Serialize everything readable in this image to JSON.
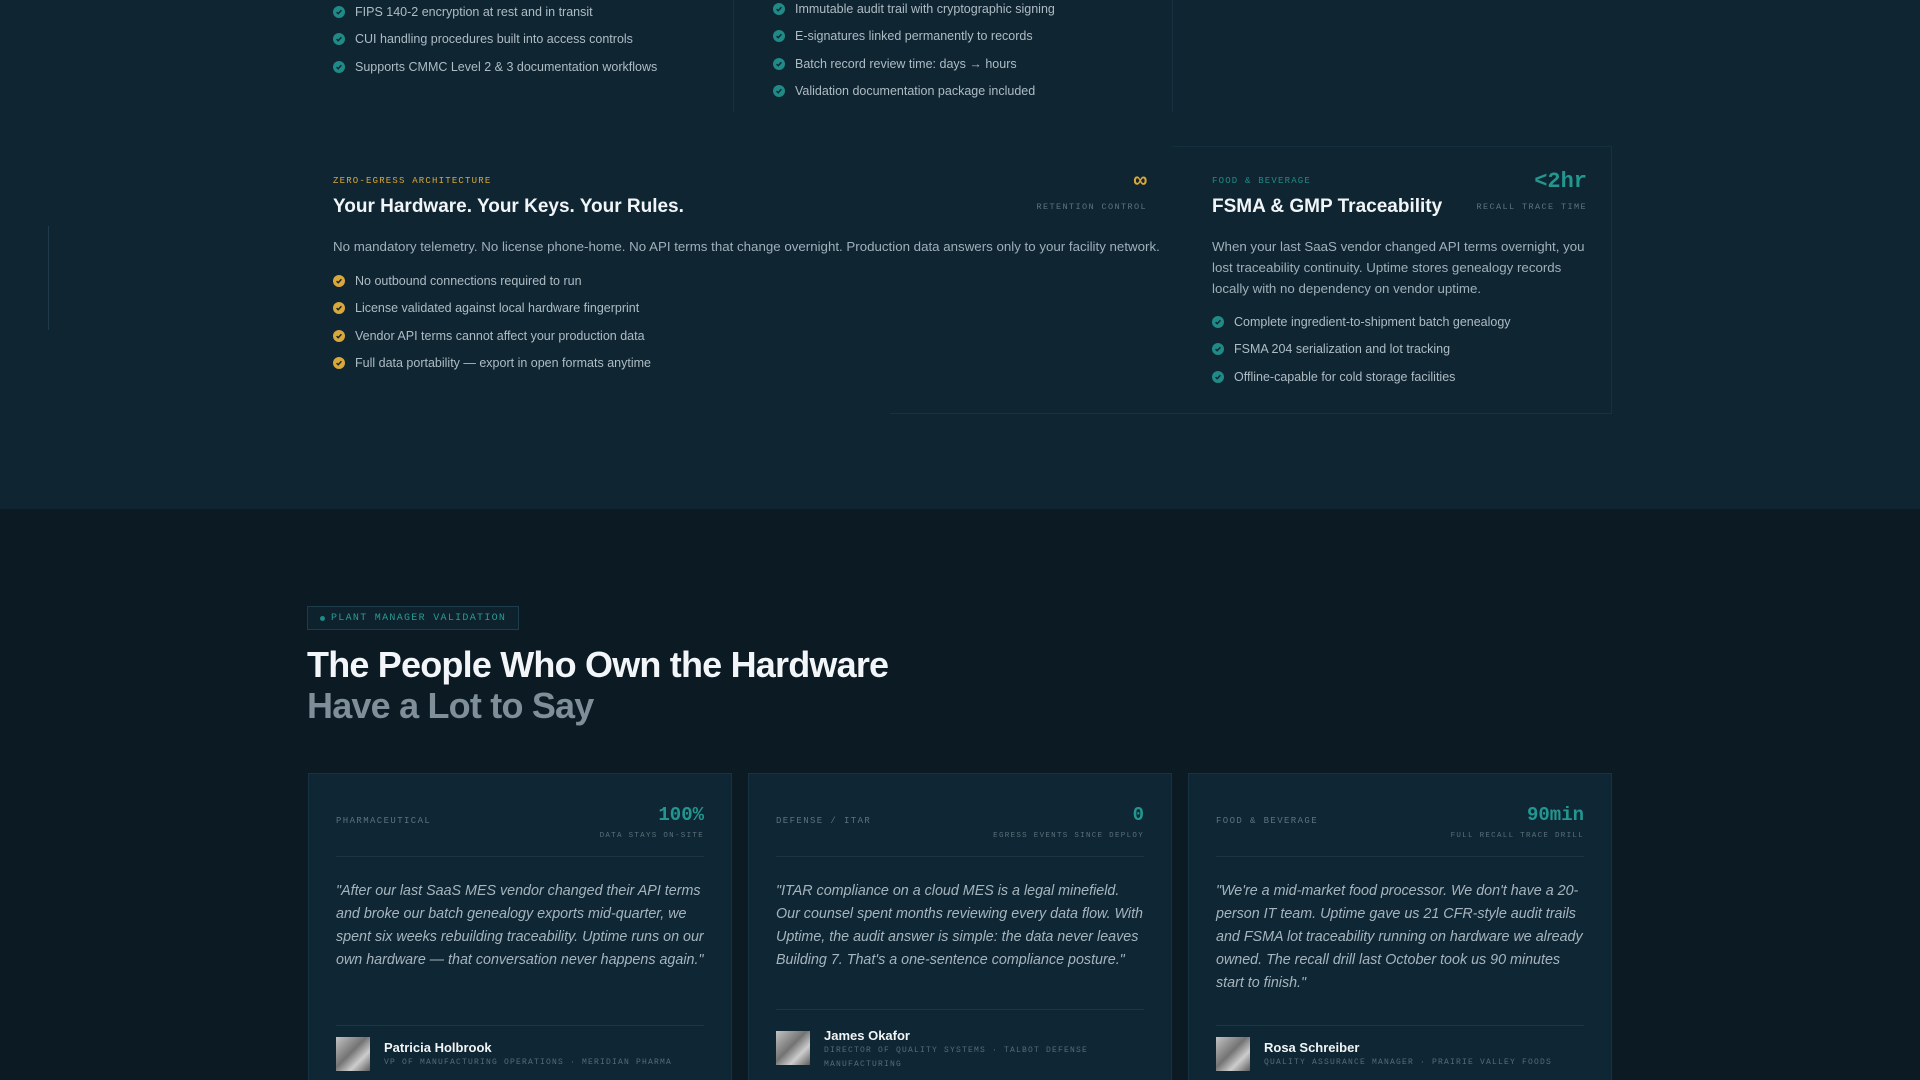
{
  "colors": {
    "accent_teal": "#1f8a86",
    "accent_gold": "#d9a73a",
    "background_top": "#0f2532",
    "background_bottom": "#0b1a23"
  },
  "top_lists": {
    "left": [
      "FIPS 140-2 encryption at rest and in transit",
      "CUI handling procedures built into access controls",
      "Supports CMMC Level 2 & 3 documentation workflows"
    ],
    "middle": [
      "Immutable audit trail with cryptographic signing",
      "E-signatures linked permanently to records",
      "Batch record review time: days → hours",
      "Validation documentation package included"
    ]
  },
  "zero_egress_card": {
    "eyebrow": "ZERO-EGRESS ARCHITECTURE",
    "title": "Your Hardware. Your Keys. Your Rules.",
    "stat_value": "∞",
    "stat_label": "RETENTION CONTROL",
    "description": "No mandatory telemetry. No license phone-home. No API terms that change overnight. Production data answers only to your facility network.",
    "items": [
      "No outbound connections required to run",
      "License validated against local hardware fingerprint",
      "Vendor API terms cannot affect your production data",
      "Full data portability — export in open formats anytime"
    ]
  },
  "fsma_card": {
    "eyebrow": "FOOD & BEVERAGE",
    "title": "FSMA & GMP Traceability",
    "stat_value": "<2hr",
    "stat_label": "RECALL TRACE TIME",
    "description": "When your last SaaS vendor changed API terms overnight, you lost traceability continuity. Uptime stores genealogy records locally with no dependency on vendor uptime.",
    "items": [
      "Complete ingredient-to-shipment batch genealogy",
      "FSMA 204 serialization and lot tracking",
      "Offline-capable for cold storage facilities"
    ]
  },
  "validation": {
    "pill": "PLANT MANAGER VALIDATION",
    "heading": "The People Who Own the Hardware",
    "subheading": "Have a Lot to Say"
  },
  "testimonials": [
    {
      "industry": "PHARMACEUTICAL",
      "stat_value": "100%",
      "stat_label": "DATA STAYS ON-SITE",
      "quote": "\"After our last SaaS MES vendor changed their API terms and broke our batch genealogy exports mid-quarter, we spent six weeks rebuilding traceability. Uptime runs on our own hardware — that conversation never happens again.\"",
      "name": "Patricia Holbrook",
      "role": "VP OF MANUFACTURING OPERATIONS · MERIDIAN PHARMA"
    },
    {
      "industry": "DEFENSE / ITAR",
      "stat_value": "0",
      "stat_label": "EGRESS EVENTS SINCE DEPLOY",
      "quote": "\"ITAR compliance on a cloud MES is a legal minefield. Our counsel spent months reviewing every data flow. With Uptime, the audit answer is simple: the data never leaves Building 7. That's a one-sentence compliance posture.\"",
      "name": "James Okafor",
      "role": "DIRECTOR OF QUALITY SYSTEMS · TALBOT DEFENSE MANUFACTURING"
    },
    {
      "industry": "FOOD & BEVERAGE",
      "stat_value": "90min",
      "stat_label": "FULL RECALL TRACE DRILL",
      "quote": "\"We're a mid-market food processor. We don't have a 20-person IT team. Uptime gave us 21 CFR-style audit trails and FSMA lot traceability running on hardware we already owned. The recall drill last October took us 90 minutes start to finish.\"",
      "name": "Rosa Schreiber",
      "role": "QUALITY ASSURANCE MANAGER · PRAIRIE VALLEY FOODS"
    }
  ]
}
